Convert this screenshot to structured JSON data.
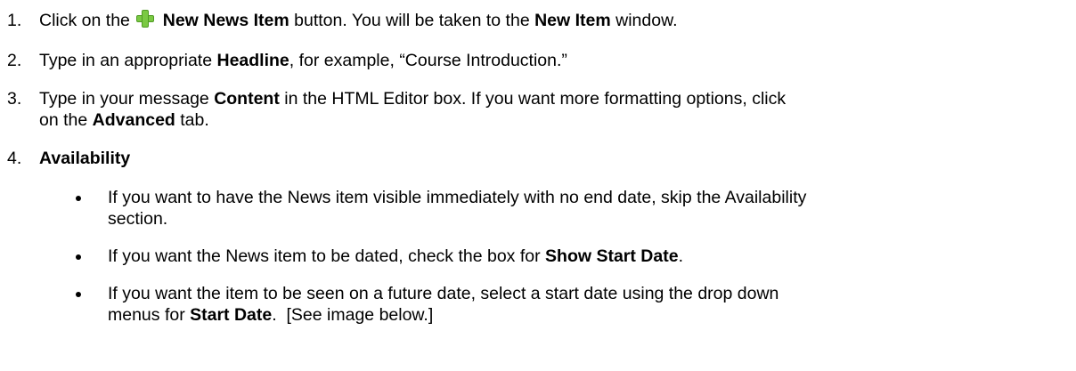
{
  "steps": [
    {
      "number": "1.",
      "parts": {
        "a": "Click on the",
        "b": "New News Item",
        "c": "button. You will be taken to the",
        "d": "New Item",
        "e": "window."
      },
      "icon": "green-plus-icon",
      "icon_color": "#7ac943"
    },
    {
      "number": "2.",
      "parts": {
        "a": "Type in an appropriate",
        "b": "Headline",
        "c": ", for example, “Course Introduction.”"
      }
    },
    {
      "number": "3.",
      "parts": {
        "a": "Type in your message",
        "b": "Content",
        "c": "in the HTML Editor box. If you want more formatting options, click",
        "d": "on the",
        "e": "Advanced",
        "f": "tab."
      }
    },
    {
      "number": "4.",
      "parts": {
        "a": "Availability"
      }
    }
  ],
  "bullets": [
    {
      "a": "If you want to have the News item visible immediately with no end date, skip the Availability",
      "b": "section."
    },
    {
      "a": "If you want the News item to be dated, check the box for",
      "b": "Show Start Date",
      "c": "."
    },
    {
      "a": "If you want the item to be seen on a future date, select a start date using the drop down",
      "b": "menus for",
      "c": "Start Date",
      "d": ".  [See image below.]"
    }
  ]
}
